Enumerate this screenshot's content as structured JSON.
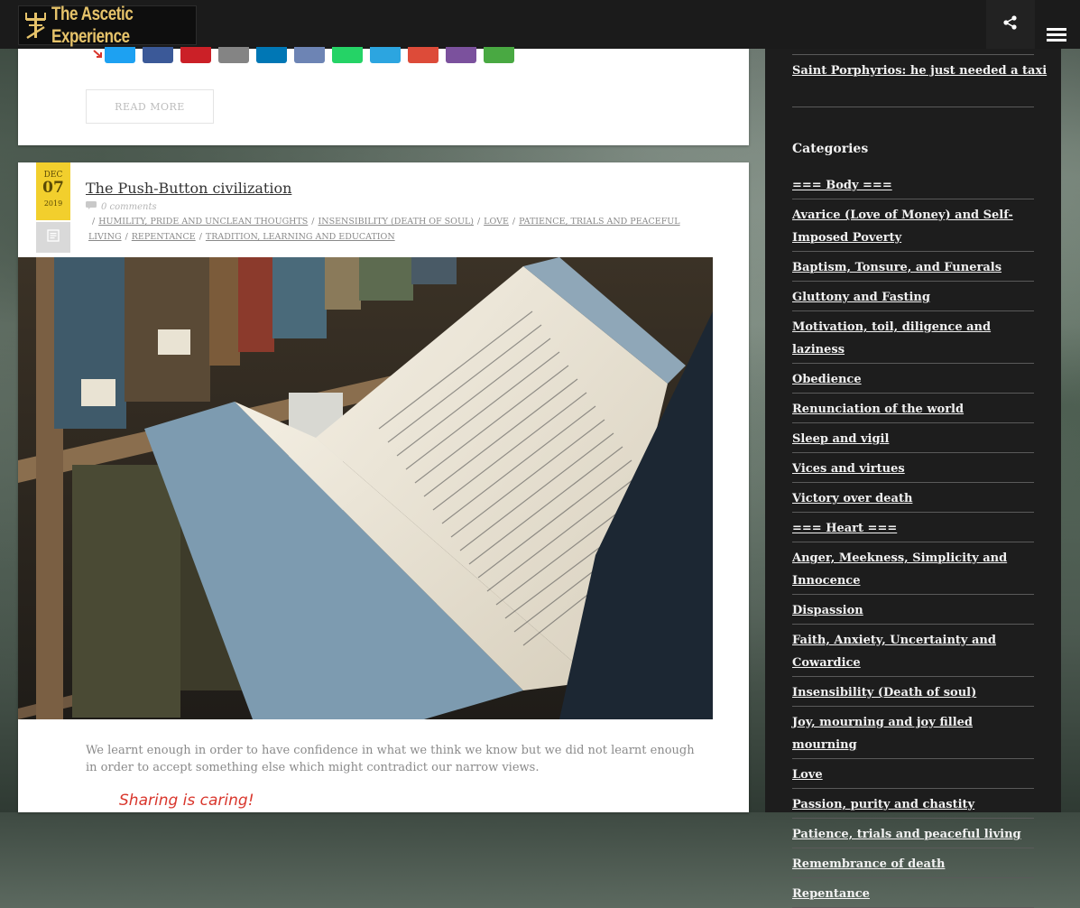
{
  "header": {
    "logo_text": "The Ascetic Experience",
    "share_icon": "share-icon",
    "menu_icon": "hamburger-menu-icon"
  },
  "previous_post": {
    "share_buttons": [
      {
        "name": "twitter",
        "color": "#1da1f2"
      },
      {
        "name": "facebook",
        "color": "#3b5998"
      },
      {
        "name": "pinterest",
        "color": "#cb2027"
      },
      {
        "name": "email",
        "color": "#848484"
      },
      {
        "name": "linkedin",
        "color": "#0077b5"
      },
      {
        "name": "print",
        "color": "#6d84b4"
      },
      {
        "name": "whatsapp",
        "color": "#25d366"
      },
      {
        "name": "telegram",
        "color": "#2ca5e0"
      },
      {
        "name": "gmail",
        "color": "#dd4b39"
      },
      {
        "name": "viber",
        "color": "#7b519d"
      },
      {
        "name": "share-link",
        "color": "#49a942"
      }
    ],
    "read_more_label": "READ MORE"
  },
  "post": {
    "date_month": "DEC",
    "date_day": "07",
    "date_year": "2019",
    "title": "The Push-Button civilization",
    "comments": "0 comments",
    "tags": [
      "HUMILITY, PRIDE AND UNCLEAN THOUGHTS",
      "INSENSIBILITY (DEATH OF SOUL)",
      "LOVE",
      "PATIENCE, TRIALS AND PEACEFUL LIVING",
      "REPENTANCE",
      "TRADITION, LEARNING AND EDUCATION"
    ],
    "excerpt": "We learnt enough in order to have confidence in what we think we know but we did not learnt enough in order to accept something else which might contradict our narrow views.",
    "sharing_label": "Sharing is caring!"
  },
  "sidebar": {
    "top_link": "Saint Porphyrios: he just needed a taxi",
    "categories_title": "Categories",
    "categories": [
      "=== Body ===",
      "Avarice (Love of Money) and Self-Imposed Poverty",
      "Baptism, Tonsure, and Funerals",
      "Gluttony and Fasting",
      "Motivation, toil, diligence and laziness",
      "Obedience",
      "Renunciation of the world",
      "Sleep and vigil",
      "Vices and virtues",
      "Victory over death",
      "=== Heart ===",
      "Anger, Meekness, Simplicity and Innocence",
      "Dispassion",
      "Faith, Anxiety, Uncertainty and Cowardice",
      "Insensibility (Death of soul)",
      "Joy, mourning and joy filled mourning",
      "Love",
      "Passion, purity and chastity",
      "Patience, trials and peaceful living",
      "Remembrance of death",
      "Repentance"
    ]
  }
}
